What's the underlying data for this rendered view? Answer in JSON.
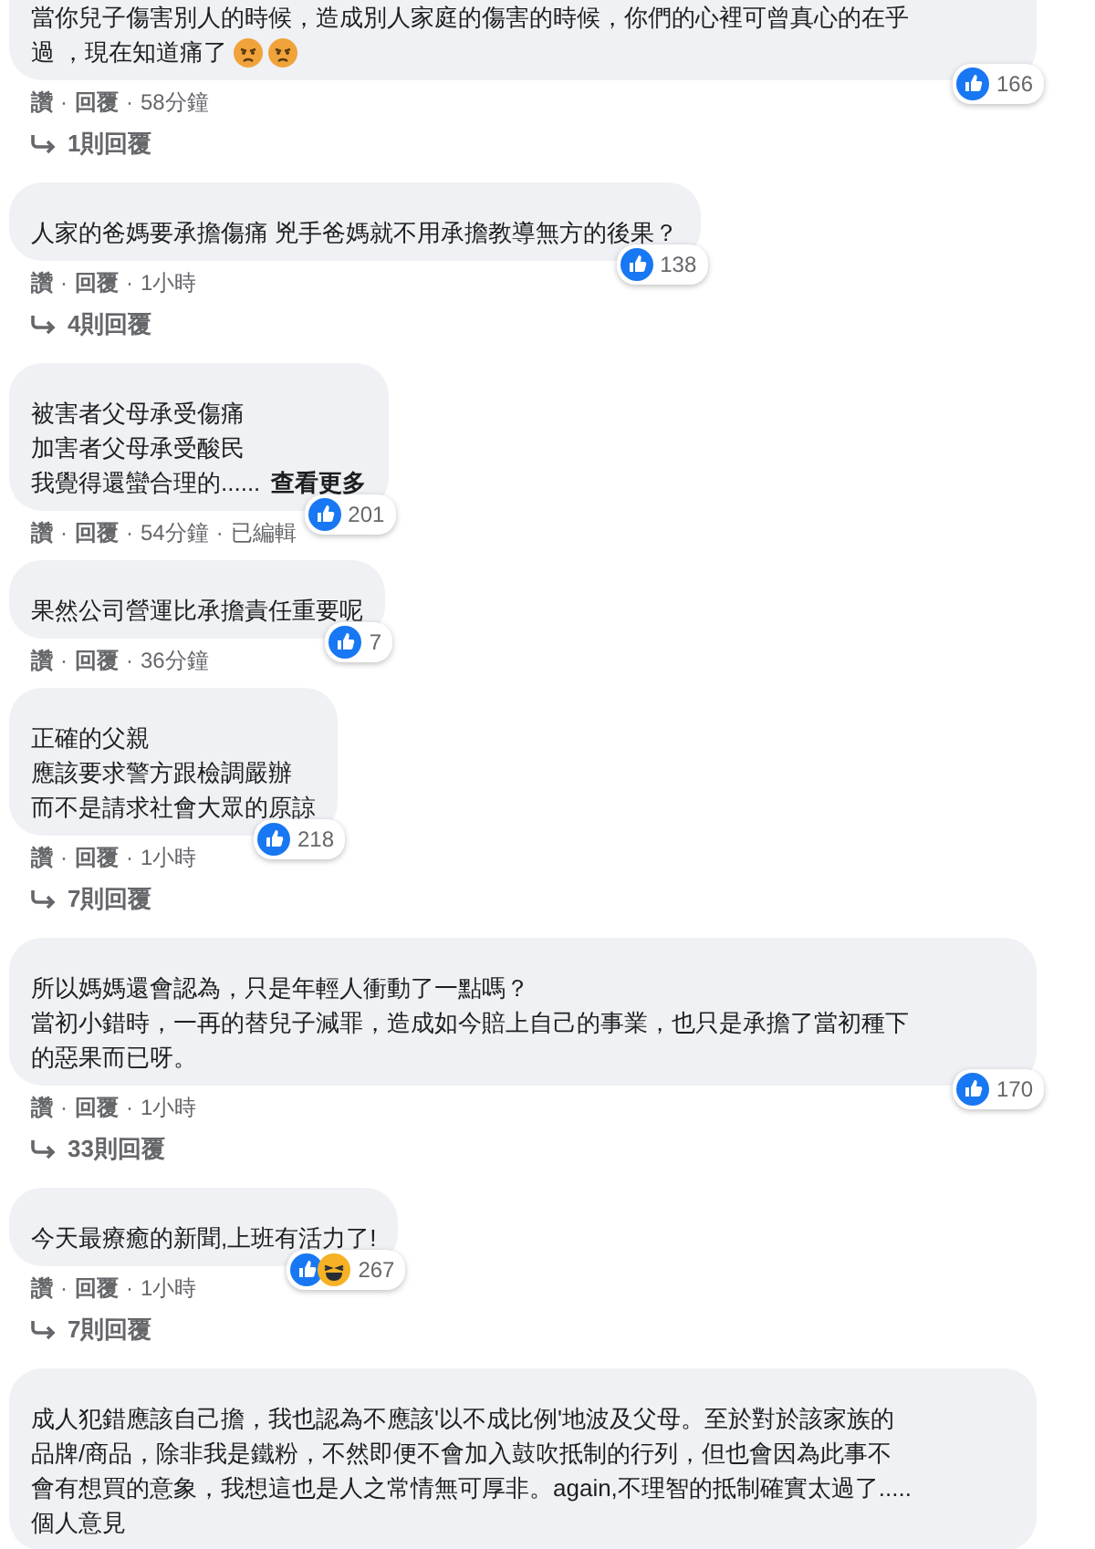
{
  "separator": "·",
  "comments": [
    {
      "lines": [
        "當你兒子傷害別人的時候，造成別人家庭的傷害的時候，你們的心裡可曾真心的在乎",
        "過 ，現在知道痛了"
      ],
      "trailing_emoji": [
        {
          "kind": "angry"
        },
        {
          "kind": "angry"
        }
      ],
      "reactions": [
        {
          "kind": "like"
        }
      ],
      "reaction_count": "166",
      "meta": [
        "讚",
        "回覆",
        "58分鐘"
      ],
      "replies": "1則回覆"
    },
    {
      "lines": [
        "人家的爸媽要承擔傷痛 兇手爸媽就不用承擔教導無方的後果？"
      ],
      "reactions": [
        {
          "kind": "like"
        }
      ],
      "reaction_count": "138",
      "meta": [
        "讚",
        "回覆",
        "1小時"
      ],
      "replies": "4則回覆"
    },
    {
      "lines": [
        "被害者父母承受傷痛",
        "加害者父母承受酸民",
        "我覺得還蠻合理的......"
      ],
      "see_more": "查看更多",
      "reactions": [
        {
          "kind": "like"
        }
      ],
      "reaction_count": "201",
      "meta": [
        "讚",
        "回覆",
        "54分鐘",
        "已編輯"
      ]
    },
    {
      "lines": [
        "果然公司營運比承擔責任重要呢"
      ],
      "reactions": [
        {
          "kind": "like"
        }
      ],
      "reaction_count": "7",
      "meta": [
        "讚",
        "回覆",
        "36分鐘"
      ]
    },
    {
      "lines": [
        "正確的父親",
        "應該要求警方跟檢調嚴辦",
        "而不是請求社會大眾的原諒"
      ],
      "reactions": [
        {
          "kind": "like"
        }
      ],
      "reaction_count": "218",
      "meta": [
        "讚",
        "回覆",
        "1小時"
      ],
      "replies": "7則回覆"
    },
    {
      "lines": [
        "所以媽媽還會認為，只是年輕人衝動了一點嗎？",
        "當初小錯時，一再的替兒子減罪，造成如今賠上自己的事業，也只是承擔了當初種下",
        "的惡果而已呀。"
      ],
      "reactions": [
        {
          "kind": "like"
        }
      ],
      "reaction_count": "170",
      "meta": [
        "讚",
        "回覆",
        "1小時"
      ],
      "replies": "33則回覆"
    },
    {
      "lines": [
        "今天最療癒的新聞,上班有活力了!"
      ],
      "reactions": [
        {
          "kind": "like"
        },
        {
          "kind": "haha"
        }
      ],
      "reaction_count": "267",
      "meta": [
        "讚",
        "回覆",
        "1小時"
      ],
      "replies": "7則回覆"
    },
    {
      "lines": [
        "成人犯錯應該自己擔，我也認為不應該'以不成比例'地波及父母。至於對於該家族的",
        "品牌/商品，除非我是鐵粉，不然即便不會加入鼓吹抵制的行列，但也會因為此事不",
        "會有想買的意象，我想這也是人之常情無可厚非。again,不理智的抵制確實太過了.....",
        "個人意見"
      ]
    }
  ]
}
